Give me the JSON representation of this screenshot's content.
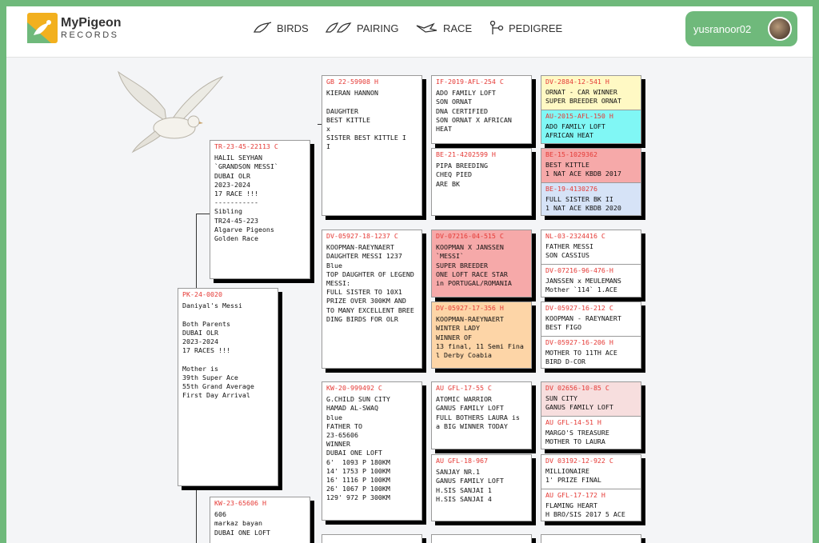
{
  "app": {
    "logo_title": "MyPigeon",
    "logo_sub": "RECORDS",
    "accent": "#6fb97b"
  },
  "nav": {
    "birds": "BIRDS",
    "pairing": "PAIRING",
    "race": "RACE",
    "pedigree": "PEDIGREE"
  },
  "user": {
    "name": "yusranoor02"
  },
  "colors": {
    "ring": "#e53935",
    "yellow": "#fff9c4",
    "cyan": "#80f7f5",
    "red": "#f6a9a9",
    "blue": "#d6e3f7",
    "orange": "#fdd5a7",
    "pink": "#f7dede"
  },
  "pedigree": {
    "subject": {
      "ring": "PK-24-0020",
      "text": "Daniyal's Messi\n\nBoth Parents\nDUBAI OLR\n2023-2024\n17 RACES !!!\n\nMother is\n39th Super Ace\n55th Grand Average\nFirst Day Arrival"
    },
    "sire": {
      "ring": "TR-23-45-22113 C",
      "text": "HALIL SEYHAN\n`GRANDSON MESSI`\nDUBAI OLR\n2023-2024\n17 RACE !!!\n-----------\nSibling\nTR24-45-223\nAlgarve Pigeons\nGolden Race"
    },
    "dam": {
      "ring": "KW-23-65606 H",
      "text": "606\nmarkaz bayan\nDUBAI ONE LOFT"
    },
    "ss": {
      "ring": "GB 22-59908 H",
      "text": "KIERAN HANNON\n\nDAUGHTER\nBEST KITTLE\nx\nSISTER BEST KITTLE I\nI"
    },
    "sd": {
      "ring": "DV-05927-18-1237 C",
      "text": "KOOPMAN-RAEYNAERT\nDAUGHTER MESSI 1237\nBlue\nTOP DAUGHTER OF LEGEND MESSI:\nFULL SISTER TO 10X1\nPRIZE OVER 300KM AND\nTO MANY EXCELLENT BREEDING BIRDS FOR OLR"
    },
    "ds": {
      "ring": "KW-20-999492 C",
      "text": "G.CHILD SUN CITY\nHAMAD AL-SWAQ\nblue\nFATHER TO\n23-65606\nWINNER\nDUBAI ONE LOFT\n6'  1093 P 180KM\n14' 1753 P 100KM\n16' 1116 P 100KM\n26' 1067 P 100KM\n129' 972 P 300KM"
    },
    "sss": {
      "ring": "IF-2019-AFL-254 C",
      "text": "ADO FAMILY LOFT\nSON ORNAT\nDNA CERTIFIED\nSON ORNAT X AFRICAN\nHEAT"
    },
    "ssd": {
      "ring": "BE-21-4202599 H",
      "text": "PIPA BREEDING\nCHEQ PIED\nARE BK"
    },
    "sds": {
      "ring": "DV-07216-04-515 C",
      "text": "KOOPMAN X JANSSEN\n`MESSI`\nSUPER BREEDER\nONE LOFT RACE STAR\nin PORTUGAL/ROMANIA"
    },
    "sdd": {
      "ring": "DV-05927-17-356 H",
      "text": "KOOPMAN-RAEYNAERT\nWINTER LADY\nWINNER OF\n13 final, 11 Semi Final Derby Coabia"
    },
    "dss": {
      "ring": "AU GFL-17-55 C",
      "text": "ATOMIC WARRIOR\nGANUS FAMILY LOFT\nFULL BOTHERS LAURA is a BIG WINNER TODAY"
    },
    "dsd": {
      "ring": "AU GFL-18-967",
      "text": "SANJAY NR.1\nGANUS FAMILY LOFT\nH.SIS SANJAI 1\nH.SIS SANJAI 4"
    },
    "g1": {
      "ring": "DV-2884-12-541 H",
      "text": "ORNAT - CAR WINNER\nSUPER BREEDER ORNAT"
    },
    "g2": {
      "ring": "AU-2015-AFL-150 H",
      "text": "ADO FAMILY LOFT\nAFRICAN HEAT"
    },
    "g3": {
      "ring": "BE-15-1029362",
      "text": "BEST KITTLE\n1 NAT ACE KBDB 2017"
    },
    "g4": {
      "ring": "BE-19-4130276",
      "text": "FULL SISTER BK II\n1 NAT ACE KBDB 2020"
    },
    "g5": {
      "ring": "NL-03-2324416 C",
      "text": "FATHER MESSI\nSON CASSIUS"
    },
    "g6": {
      "ring": "DV-07216-96-476-H",
      "text": "JANSSEN x MEULEMANS\nMother `114` 1.ACE"
    },
    "g7": {
      "ring": "DV-05927-16-212 C",
      "text": "KOOPMAN - RAEYNAERT\nBEST FIGO"
    },
    "g8": {
      "ring": "DV-05927-16-206 H",
      "text": "MOTHER TO 11TH ACE\nBIRD D-COR"
    },
    "g9": {
      "ring": "DV 02656-10-85 C",
      "text": "SUN CITY\nGANUS FAMILY LOFT"
    },
    "g10": {
      "ring": "AU GFL-14-51 H",
      "text": "MARGO'S TREASURE\nMOTHER TO LAURA"
    },
    "g11": {
      "ring": "DV 03192-12-922 C",
      "text": "MILLIONAIRE\n1' PRIZE FINAL"
    },
    "g12": {
      "ring": "AU GFL-17-172 H",
      "text": "FLAMING HEART\nH BRO/SIS 2017 5 ACE"
    }
  }
}
